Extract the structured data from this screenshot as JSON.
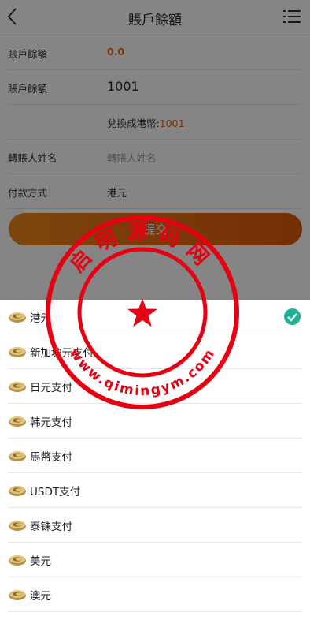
{
  "header": {
    "title": "賬戶餘額",
    "back_icon": "chevron-left-icon",
    "menu_icon": "list-menu-icon"
  },
  "form": {
    "balance": {
      "label": "賬戶餘額",
      "value": "0.0"
    },
    "amount": {
      "label": "賬戶餘額",
      "value": "1001"
    },
    "conversion": {
      "label": "兌換成港幣:",
      "value": "1001"
    },
    "payer_name": {
      "label": "轉賬人姓名",
      "placeholder": "轉賬人姓名"
    },
    "payment_method": {
      "label": "付款方式",
      "value": "港元"
    },
    "submit_label": "提交"
  },
  "options": [
    {
      "label": "港元",
      "selected": true
    },
    {
      "label": "新加坡元支付",
      "selected": false
    },
    {
      "label": "日元支付",
      "selected": false
    },
    {
      "label": "韩元支付",
      "selected": false
    },
    {
      "label": "馬幣支付",
      "selected": false
    },
    {
      "label": "USDT支付",
      "selected": false
    },
    {
      "label": "泰铢支付",
      "selected": false
    },
    {
      "label": "美元",
      "selected": false
    },
    {
      "label": "澳元",
      "selected": false
    }
  ],
  "watermark": {
    "top_text": "启明源码网",
    "url": "www.qimingym.com"
  },
  "colors": {
    "accent": "#e0681b",
    "check": "#1ab394",
    "stamp": "#e60012"
  }
}
